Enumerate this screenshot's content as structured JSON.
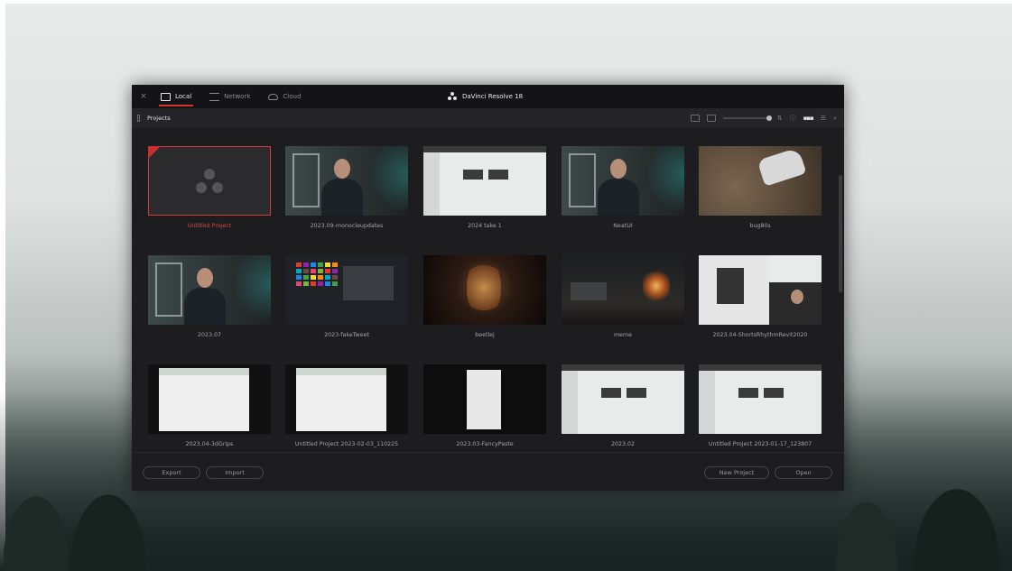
{
  "window": {
    "close_glyph": "×",
    "tabs": [
      {
        "label": "Local",
        "icon": "hard-drive-icon",
        "active": true
      },
      {
        "label": "Network",
        "icon": "network-icon",
        "active": false
      },
      {
        "label": "Cloud",
        "icon": "cloud-icon",
        "active": false
      }
    ],
    "app_title": "DaVinci Resolve 18",
    "accent_color": "#d03636"
  },
  "toolbar": {
    "section_label": "Projects"
  },
  "projects": [
    {
      "name": "Untitled Project",
      "thumb": "new",
      "selected": true
    },
    {
      "name": "2023.09-monocleupdates",
      "thumb": "person"
    },
    {
      "name": "2024 take 1",
      "thumb": "screen"
    },
    {
      "name": "NeatUI",
      "thumb": "person"
    },
    {
      "name": "bug80s",
      "thumb": "car"
    },
    {
      "name": "2023.07",
      "thumb": "person"
    },
    {
      "name": "2023-fakeTweet",
      "thumb": "palette"
    },
    {
      "name": "beetlej",
      "thumb": "dark"
    },
    {
      "name": "meme",
      "thumb": "meme"
    },
    {
      "name": "2023.04-ShortsRhythmRevit2020",
      "thumb": "screen-person"
    },
    {
      "name": "2023.04-3dGrips",
      "thumb": "excel"
    },
    {
      "name": "Untitled Project 2023-02-03_110225",
      "thumb": "excel"
    },
    {
      "name": "2023.03-FancyPaste",
      "thumb": "black"
    },
    {
      "name": "2023.02",
      "thumb": "screen"
    },
    {
      "name": "Untitled Project 2023-01-17_123807",
      "thumb": "screen"
    }
  ],
  "footer": {
    "export_label": "Export",
    "import_label": "Import",
    "new_project_label": "New Project",
    "open_label": "Open"
  }
}
